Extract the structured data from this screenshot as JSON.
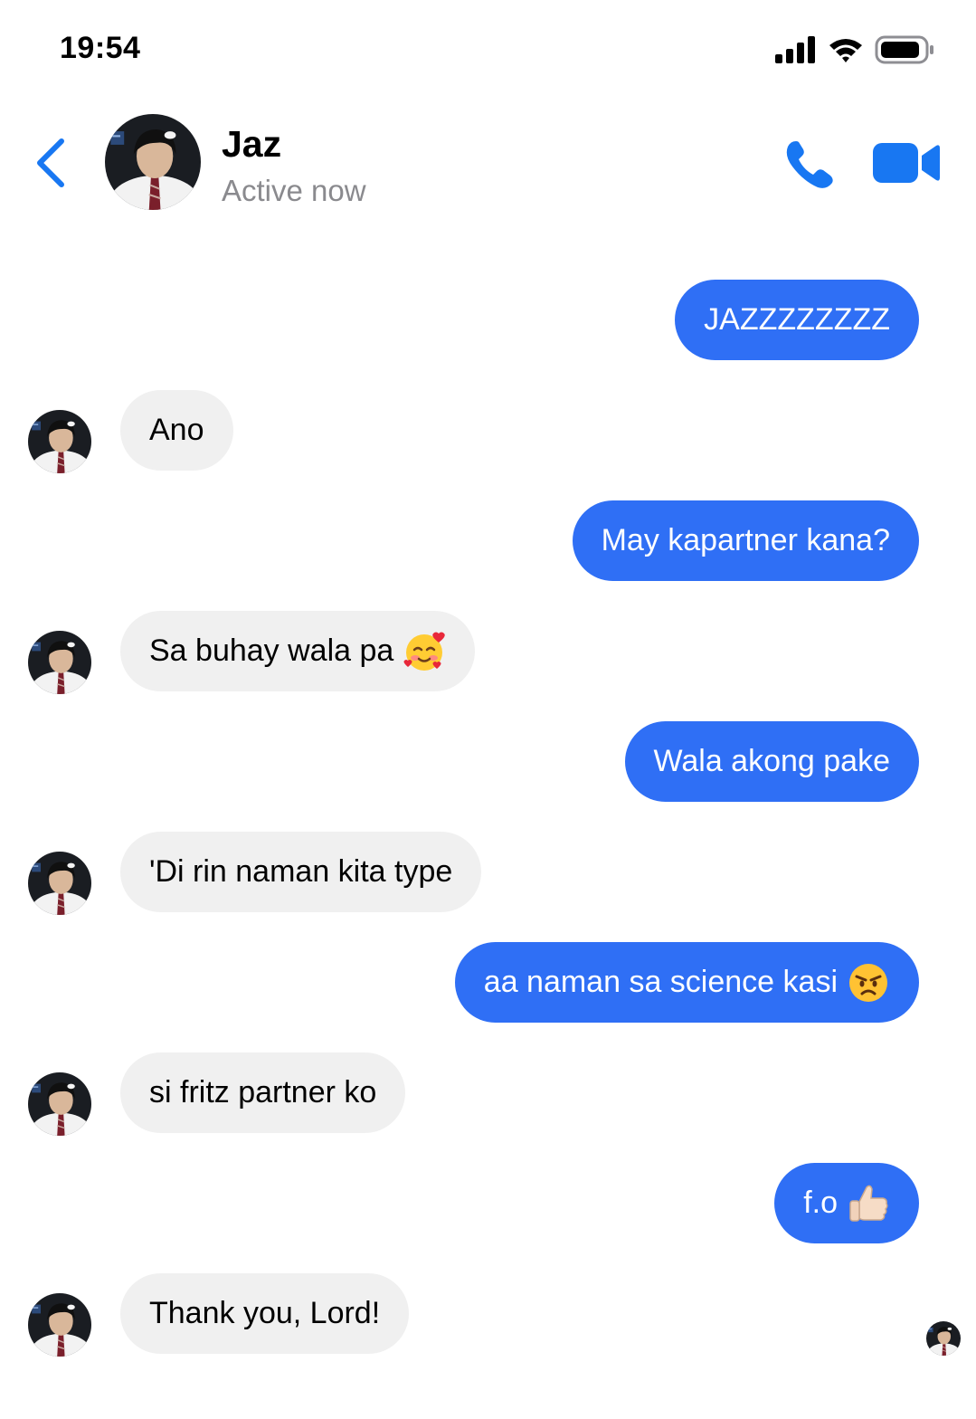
{
  "status_bar": {
    "time": "19:54"
  },
  "header": {
    "name": "Jaz",
    "status": "Active now"
  },
  "messages": [
    {
      "text": "JAZZZZZZZZ",
      "from": "me"
    },
    {
      "text": "Ano",
      "from": "them"
    },
    {
      "text": "May kapartner kana?",
      "from": "me"
    },
    {
      "text": "Sa buhay wala pa",
      "from": "them",
      "emoji": "smiling-face-with-hearts"
    },
    {
      "text": "Wala akong pake",
      "from": "me"
    },
    {
      "text": "'Di rin naman kita type",
      "from": "them"
    },
    {
      "text": "aa naman sa science kasi",
      "from": "me",
      "emoji": "angry-face"
    },
    {
      "text": "si fritz partner ko",
      "from": "them"
    },
    {
      "text": "f.o",
      "from": "me",
      "emoji": "thumbs-up"
    },
    {
      "text": "Thank you, Lord!",
      "from": "them"
    }
  ],
  "colors": {
    "accent": "#2f6ff5",
    "icon_blue": "#1877f2",
    "incoming_bubble": "#f0f0f0",
    "secondary_text": "#8a8a8e"
  }
}
